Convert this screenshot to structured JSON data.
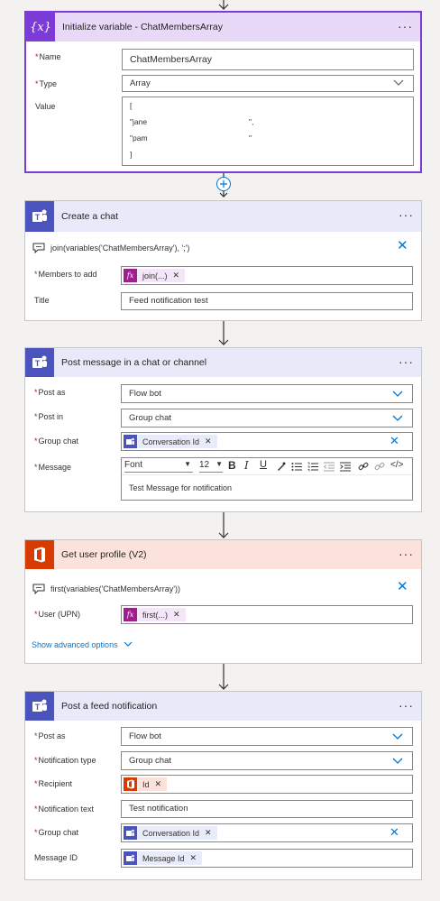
{
  "colors": {
    "variable_purple": "#7c3cd8",
    "teams_blue": "#4b53bc",
    "office_orange": "#d83b01",
    "token_fx": "#9e1e8b",
    "link_blue": "#0078d4",
    "required_red": "#a4262c"
  },
  "card1": {
    "title": "Initialize variable - ChatMembersArray",
    "icon": "variable-icon",
    "name_label": "Name",
    "name_value": "ChatMembersArray",
    "type_label": "Type",
    "type_value": "Array",
    "value_label": "Value",
    "value_lines": [
      "[",
      "\"jane",
      "\",",
      "\"pam",
      "\"",
      "]"
    ]
  },
  "card2": {
    "title": "Create a chat",
    "icon": "teams-icon",
    "expression": "join(variables('ChatMembersArray'), ';')",
    "members_label": "Members to add",
    "members_token": "join(...)",
    "title_label": "Title",
    "title_value": "Feed notification test"
  },
  "card3": {
    "title": "Post message in a chat or channel",
    "icon": "teams-icon",
    "post_as_label": "Post as",
    "post_as_value": "Flow bot",
    "post_in_label": "Post in",
    "post_in_value": "Group chat",
    "group_chat_label": "Group chat",
    "group_chat_token": "Conversation Id",
    "message_label": "Message",
    "font_label": "Font",
    "font_size": "12",
    "message_value": "Test Message for notification"
  },
  "card4": {
    "title": "Get user profile (V2)",
    "icon": "office-icon",
    "expression": "first(variables('ChatMembersArray'))",
    "user_label": "User (UPN)",
    "user_token": "first(...)",
    "advanced_link": "Show advanced options"
  },
  "card5": {
    "title": "Post a feed notification",
    "icon": "teams-icon",
    "post_as_label": "Post as",
    "post_as_value": "Flow bot",
    "ntype_label": "Notification type",
    "ntype_value": "Group chat",
    "recipient_label": "Recipient",
    "recipient_token": "Id",
    "ntext_label": "Notification text",
    "ntext_value": "Test notification",
    "group_chat_label": "Group chat",
    "group_chat_token": "Conversation Id",
    "message_id_label": "Message ID",
    "message_id_token": "Message Id"
  }
}
